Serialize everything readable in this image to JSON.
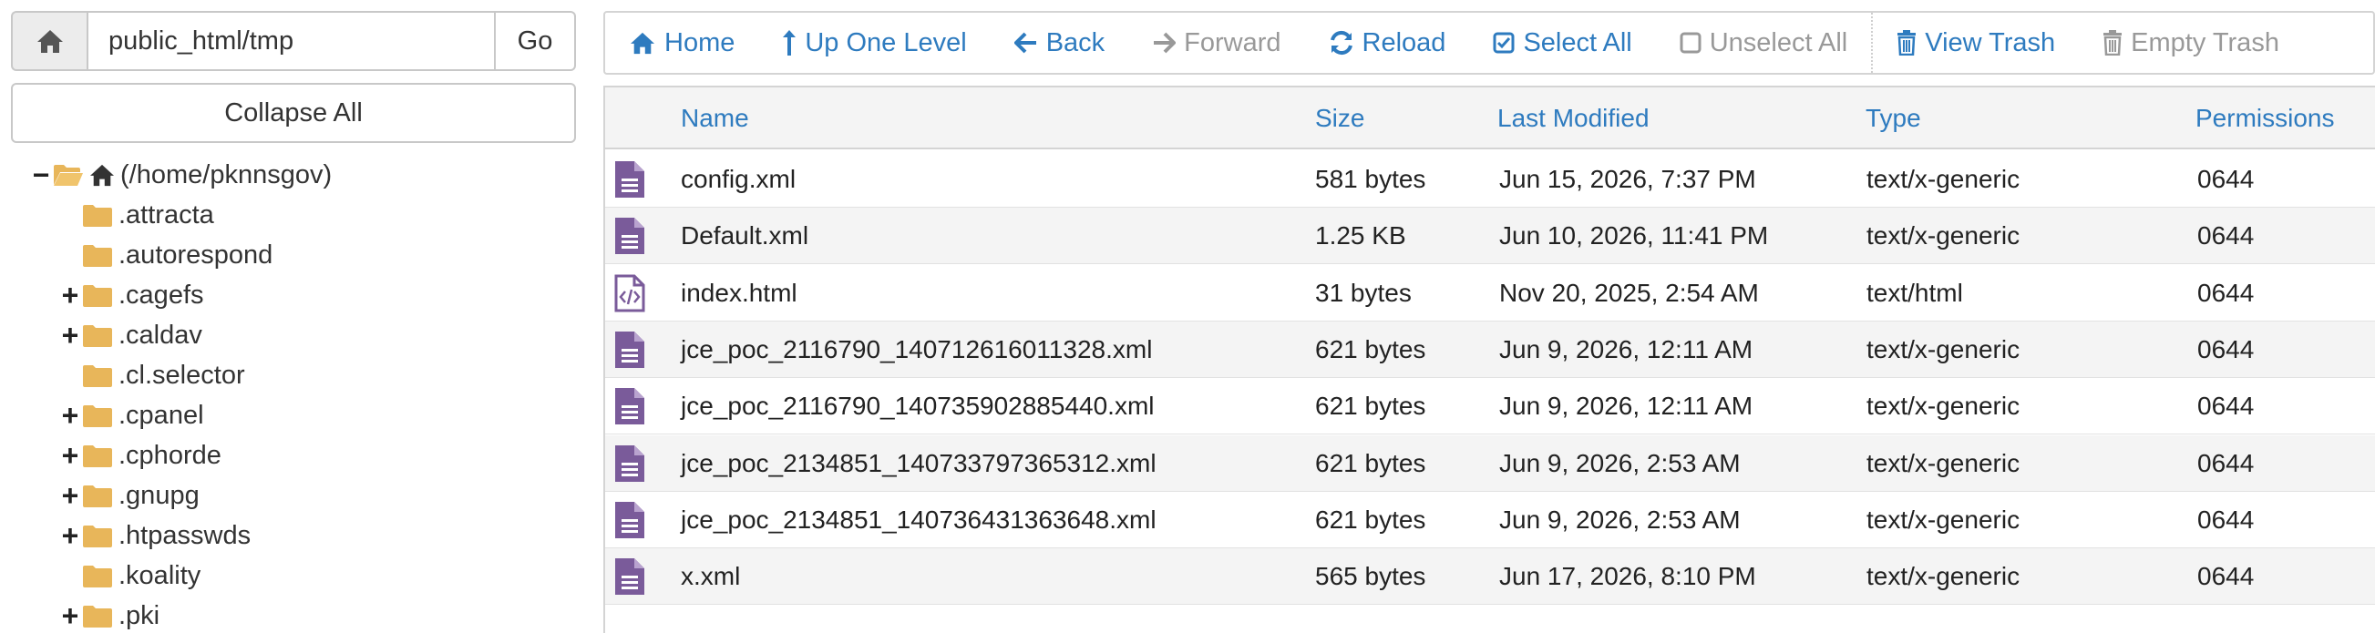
{
  "path_bar": {
    "path_value": "public_html/tmp",
    "go_label": "Go"
  },
  "collapse_label": "Collapse All",
  "tree": {
    "root_label": "(/home/pknnsgov)",
    "items": [
      {
        "label": ".attracta",
        "expandable": false
      },
      {
        "label": ".autorespond",
        "expandable": false
      },
      {
        "label": ".cagefs",
        "expandable": true
      },
      {
        "label": ".caldav",
        "expandable": true
      },
      {
        "label": ".cl.selector",
        "expandable": false
      },
      {
        "label": ".cpanel",
        "expandable": true
      },
      {
        "label": ".cphorde",
        "expandable": true
      },
      {
        "label": ".gnupg",
        "expandable": true
      },
      {
        "label": ".htpasswds",
        "expandable": true
      },
      {
        "label": ".koality",
        "expandable": false
      },
      {
        "label": ".pki",
        "expandable": true
      }
    ]
  },
  "toolbar": {
    "home": "Home",
    "up": "Up One Level",
    "back": "Back",
    "forward": "Forward",
    "reload": "Reload",
    "select_all": "Select All",
    "unselect_all": "Unselect All",
    "view_trash": "View Trash",
    "empty_trash": "Empty Trash"
  },
  "table": {
    "headers": {
      "name": "Name",
      "size": "Size",
      "modified": "Last Modified",
      "type": "Type",
      "perms": "Permissions"
    },
    "rows": [
      {
        "name": "config.xml",
        "size": "581 bytes",
        "modified": "Jun 15, 2026, 7:37 PM",
        "type": "text/x-generic",
        "perms": "0644",
        "icon": "text-file-icon"
      },
      {
        "name": "Default.xml",
        "size": "1.25 KB",
        "modified": "Jun 10, 2026, 11:41 PM",
        "type": "text/x-generic",
        "perms": "0644",
        "icon": "text-file-icon"
      },
      {
        "name": "index.html",
        "size": "31 bytes",
        "modified": "Nov 20, 2025, 2:54 AM",
        "type": "text/html",
        "perms": "0644",
        "icon": "code-file-icon"
      },
      {
        "name": "jce_poc_2116790_140712616011328.xml",
        "size": "621 bytes",
        "modified": "Jun 9, 2026, 12:11 AM",
        "type": "text/x-generic",
        "perms": "0644",
        "icon": "text-file-icon"
      },
      {
        "name": "jce_poc_2116790_140735902885440.xml",
        "size": "621 bytes",
        "modified": "Jun 9, 2026, 12:11 AM",
        "type": "text/x-generic",
        "perms": "0644",
        "icon": "text-file-icon"
      },
      {
        "name": "jce_poc_2134851_140733797365312.xml",
        "size": "621 bytes",
        "modified": "Jun 9, 2026, 2:53 AM",
        "type": "text/x-generic",
        "perms": "0644",
        "icon": "text-file-icon"
      },
      {
        "name": "jce_poc_2134851_140736431363648.xml",
        "size": "621 bytes",
        "modified": "Jun 9, 2026, 2:53 AM",
        "type": "text/x-generic",
        "perms": "0644",
        "icon": "text-file-icon"
      },
      {
        "name": "x.xml",
        "size": "565 bytes",
        "modified": "Jun 17, 2026, 8:10 PM",
        "type": "text/x-generic",
        "perms": "0644",
        "icon": "text-file-icon"
      }
    ]
  },
  "colors": {
    "link": "#2e7bbf",
    "folder": "#e8b65a",
    "file_icon": "#7a5b9a"
  }
}
